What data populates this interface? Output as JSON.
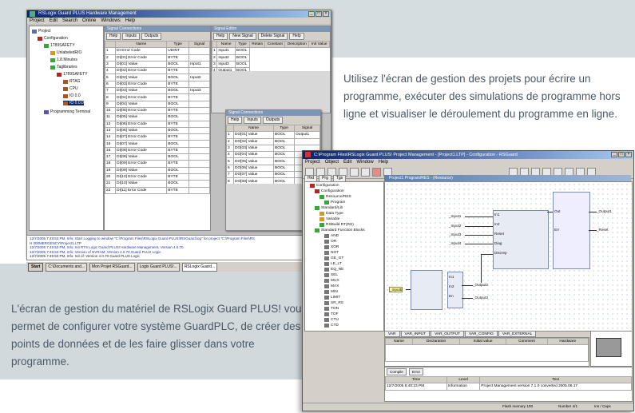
{
  "captions": {
    "right": "Utilisez l'écran de gestion des projets pour écrire un programme, exécuter des simulations de programme hors ligne et visualiser le déroulement du programme en ligne.",
    "left": "L'écran de gestion du matériel de RSLogix Guard PLUS! vous permet de configurer votre système GuardPLC, de créer des points de données et de les faire glisser dans votre programme."
  },
  "window1": {
    "title": "RSLogix Guard PLUS Hardware Management",
    "menu": [
      "Project",
      "Edit",
      "Search",
      "Online",
      "Windows",
      "Help"
    ],
    "tree": [
      "Project",
      "Configuration",
      "1789SAFETY",
      "UnlabeledRIO",
      "1.8.Minutes",
      "Taglibraries",
      "1789SAFETY",
      "RTAG",
      "CPU",
      "IO 0.0",
      "IO 0.0.0",
      "Programming Terminal"
    ],
    "grid_panel": {
      "title": "Signal Connections",
      "tabs": [
        "Help",
        "Inputs",
        "Outputs"
      ],
      "columns": [
        "",
        "Name",
        "Type",
        "Signal"
      ],
      "rows": [
        [
          "1",
          "DI Error Code",
          "UDINT",
          ""
        ],
        [
          "2",
          "DI[01] Error Code",
          "BYTE",
          ""
        ],
        [
          "3",
          "DI[01] Value",
          "BOOL",
          "Input1"
        ],
        [
          "4",
          "DI[02] Error Code",
          "BYTE",
          ""
        ],
        [
          "5",
          "DI[02] Value",
          "BOOL",
          "Input2"
        ],
        [
          "6",
          "DI[03] Error Code",
          "BYTE",
          ""
        ],
        [
          "7",
          "DI[03] Value",
          "BOOL",
          "Input3"
        ],
        [
          "8",
          "DI[04] Error Code",
          "BYTE",
          ""
        ],
        [
          "9",
          "DI[04] Value",
          "BOOL",
          ""
        ],
        [
          "10",
          "DI[05] Error Code",
          "BYTE",
          ""
        ],
        [
          "11",
          "DI[05] Value",
          "BOOL",
          ""
        ],
        [
          "12",
          "DI[06] Error Code",
          "BYTE",
          ""
        ],
        [
          "13",
          "DI[06] Value",
          "BOOL",
          ""
        ],
        [
          "14",
          "DI[07] Error Code",
          "BYTE",
          ""
        ],
        [
          "15",
          "DI[07] Value",
          "BOOL",
          ""
        ],
        [
          "16",
          "DI[08] Error Code",
          "BYTE",
          ""
        ],
        [
          "17",
          "DI[08] Value",
          "BOOL",
          ""
        ],
        [
          "18",
          "DI[09] Error Code",
          "BYTE",
          ""
        ],
        [
          "19",
          "DI[09] Value",
          "BOOL",
          ""
        ],
        [
          "20",
          "DI[10] Error Code",
          "BYTE",
          ""
        ],
        [
          "21",
          "DI[10] Value",
          "BOOL",
          ""
        ],
        [
          "22",
          "DI[11] Error Code",
          "BYTE",
          ""
        ]
      ]
    },
    "signals_panel": {
      "title": "Signal Editor",
      "tabs": [
        "Help",
        "New Signal",
        "Delete Signal",
        "Help"
      ],
      "columns": [
        "",
        "Name",
        "Type",
        "Retain",
        "Constant",
        "Description",
        "Init Value"
      ],
      "rows": [
        [
          "1",
          "Input1",
          "BOOL"
        ],
        [
          "2",
          "Input2",
          "BOOL"
        ],
        [
          "3",
          "Input3",
          "BOOL"
        ],
        [
          "4",
          "Output1",
          "BOOL"
        ]
      ]
    },
    "conn_panel": {
      "title": "Signal Connections",
      "tabs": [
        "Help",
        "Inputs",
        "Outputs"
      ],
      "columns": [
        "",
        "Name",
        "Type",
        "Signal"
      ],
      "rows": [
        [
          "1",
          "DO[01] Value",
          "BOOL",
          "Output1"
        ],
        [
          "2",
          "DO[02] Value",
          "BOOL",
          ""
        ],
        [
          "3",
          "DO[03] Value",
          "BOOL",
          ""
        ],
        [
          "4",
          "DO[04] Value",
          "BOOL",
          ""
        ],
        [
          "5",
          "DO[05] Value",
          "BOOL",
          ""
        ],
        [
          "6",
          "DO[06] Value",
          "BOOL",
          ""
        ],
        [
          "7",
          "DO[07] Value",
          "BOOL",
          ""
        ],
        [
          "8",
          "DO[08] Value",
          "BOOL",
          ""
        ]
      ]
    },
    "log_lines": [
      "12/7/2005 7:49:53 PM, Info: Start Logging to window \"C:\\Program Files\\RSLogix Guard PLUS!\\RSGuard.log\" for project \"C:\\Program Files\\RS",
      "H 000MERGENCY\\Project1.LTP",
      "12/7/2005 7:49:53 PM, Info: Init RTS Logic Guard PLUS! Hardware Management, Version 4.0.70",
      "12/7/2005 7:49:53 PM, Info: Version of NVRAM: Version 4.0.70 Guard PLUS Logic",
      "12/7/2005 7:49:53 PM, Info: Init of: Version 4.0.70 Guard PLUS Logic",
      "12/7/2005 7:50:02 PM, Info: Version of: Version 4.0.70 Guard PLUS Logic"
    ],
    "taskbar": [
      "Start",
      "C:\\Documents and...",
      "Mon Projet RSGuard...",
      "Logix Guard PLUS!...",
      "RSLogix Guard..."
    ]
  },
  "window2": {
    "title": "C:\\Program Files\\RSLogix Guard PLUS! Project Management - [Project1.LTP] - Configuration - RSGuard",
    "menu": [
      "Project",
      "Object",
      "Edit",
      "Window",
      "Help"
    ],
    "tree_tabs": [
      "Hrd",
      "Prg",
      "Tgs"
    ],
    "canvas_title": "Project1 Program/RES - (Resource)",
    "tree": [
      "Configuration",
      "Configuration",
      "Resource/RES",
      "Program",
      "Standard/Lib",
      "Data Type",
      "Variable",
      "RSBuild RT(RS)",
      "Standard Function Blocks",
      "AND",
      "OR",
      "XOR",
      "NOT",
      "GE_GT",
      "LE_LT",
      "EQ_NE",
      "SEL",
      "MUX",
      "MAX",
      "MIN",
      "LIMIT",
      "SR_RS",
      "TON",
      "TOF",
      "CTU",
      "CTD"
    ],
    "signals_left": [
      "_Input1",
      "_Input2",
      "_Input3",
      "_Input4",
      "_Input5"
    ],
    "signals_right": [
      "_Output1",
      "_Reset",
      "_Output2",
      "_Output3"
    ],
    "fb1_labels": [
      "In1",
      "In2",
      "Reset",
      "Diag",
      "Discrep",
      "Out",
      "Err"
    ],
    "fb2_labels": [
      "In1",
      "In2",
      "En"
    ],
    "var_tabs": [
      "VAR",
      "VAR_INPUT",
      "VAR_OUTPUT",
      "VAR_CONFIG",
      "VAR_EXTERNAL"
    ],
    "var_columns": [
      "Name",
      "Declaration",
      "Initial value",
      "Comment",
      "Hardware"
    ],
    "msg_tabs": [
      "Compile",
      "Error"
    ],
    "msg_columns": [
      "Time",
      "Level",
      "Text"
    ],
    "msg_row": [
      "12/7/2005 8:40:23 PM",
      "Information",
      "Project Management version 7.1.0 converted 2005.06.17"
    ],
    "status": [
      "Flash memory 100",
      "Number 4/1",
      "Ins / Caps"
    ]
  },
  "colors": {
    "band": "#d6dde1",
    "caption": "#4a5963",
    "titlebar": "#0a246a"
  }
}
